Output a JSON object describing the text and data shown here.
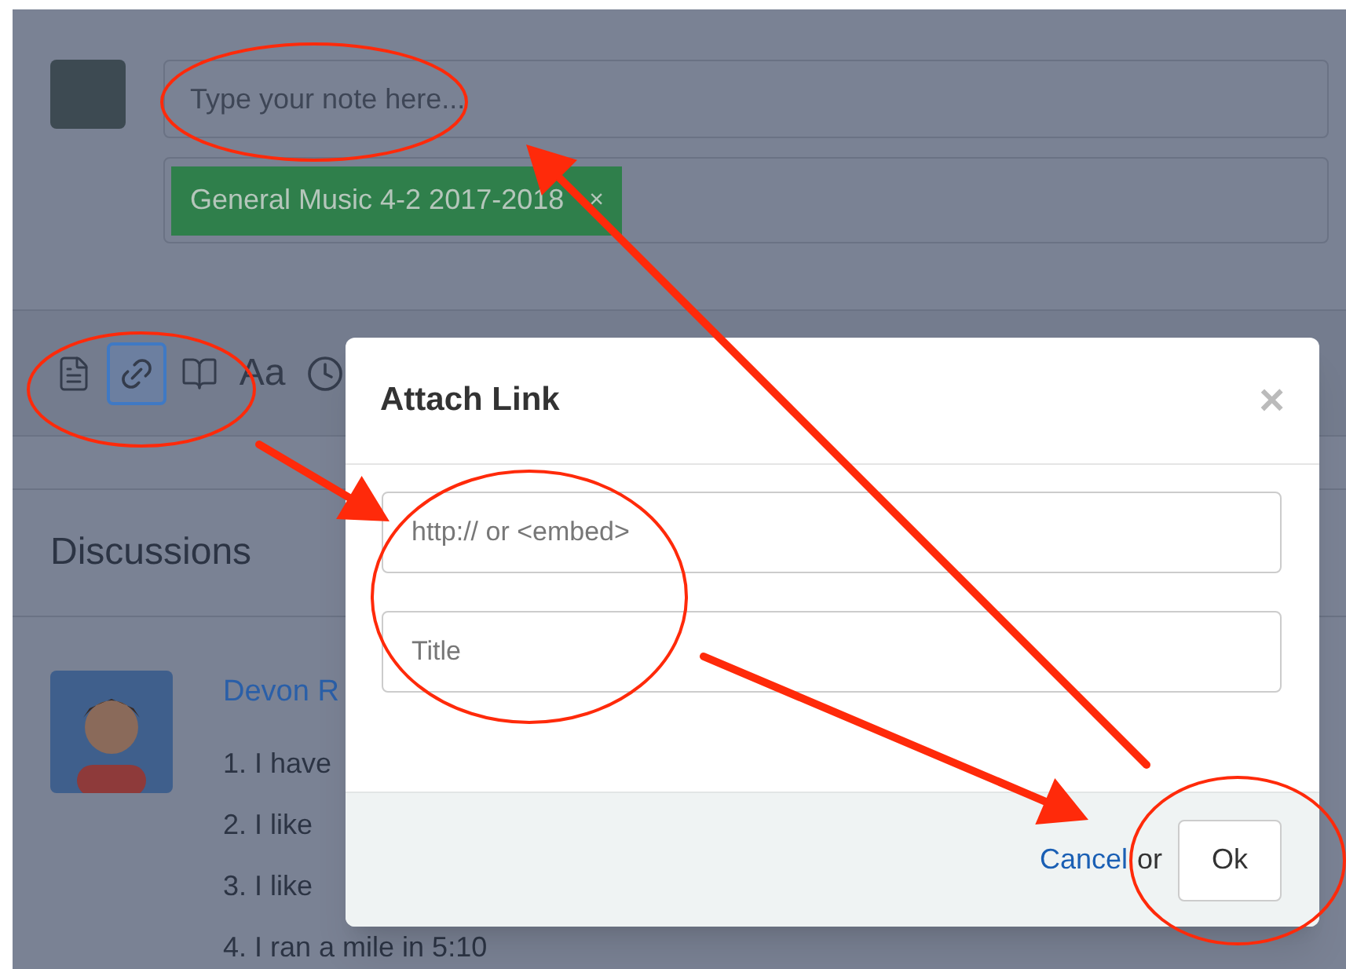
{
  "compose": {
    "note_placeholder": "Type your note here...",
    "tags": [
      {
        "label": "General Music 4-2 2017-2018",
        "remove": "×"
      }
    ]
  },
  "toolbar": {
    "items": [
      {
        "kind": "note",
        "selected": false
      },
      {
        "kind": "link",
        "selected": true
      },
      {
        "kind": "book",
        "selected": false
      },
      {
        "kind": "text",
        "label": "Aa",
        "selected": false
      },
      {
        "kind": "clock"
      }
    ]
  },
  "discussions": {
    "title": "Discussions",
    "posts": [
      {
        "author": "Devon R",
        "lines": [
          "1. I have",
          "2. I like",
          "3. I like",
          "4. I ran a mile in 5:10"
        ]
      }
    ]
  },
  "dialog": {
    "title": "Attach Link",
    "close": "×",
    "fields": [
      {
        "placeholder": "http:// or <embed>"
      },
      {
        "placeholder": "Title"
      }
    ],
    "cancel": "Cancel",
    "or": "or",
    "ok": "Ok"
  }
}
